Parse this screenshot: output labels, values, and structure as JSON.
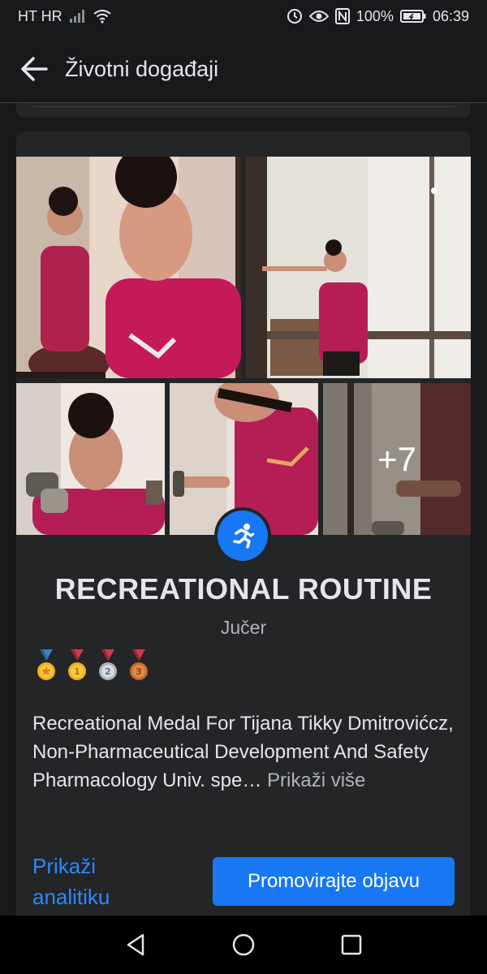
{
  "status_bar": {
    "carrier": "HT HR",
    "battery": "100%",
    "time": "06:39",
    "icons": [
      "signal-icon",
      "wifi-icon",
      "alarm-icon",
      "eye-icon",
      "nfc-icon",
      "battery-icon"
    ]
  },
  "header": {
    "title": "Životni događaji",
    "back_icon": "back-arrow-icon"
  },
  "event": {
    "more_photos_label": "+7",
    "activity_icon": "running-icon",
    "title": "RECREATIONAL ROUTINE",
    "date": "Jučer",
    "medals": [
      "medal-star-icon",
      "medal-1-icon",
      "medal-2-icon",
      "medal-3-icon"
    ],
    "text": "Recreational Medal For Tijana Tikky Dmitrovićcz, Non-Pharmaceutical Development And Safety Pharmacology Univ. spe…",
    "see_more": "Prikaži više"
  },
  "actions": {
    "analytics": "Prikaži analitiku",
    "promote": "Promovirajte objavu"
  },
  "colors": {
    "background": "#18191a",
    "card": "#242526",
    "accent": "#1877f2",
    "link": "#2d88ff",
    "secondary_text": "#b0b3b8"
  }
}
